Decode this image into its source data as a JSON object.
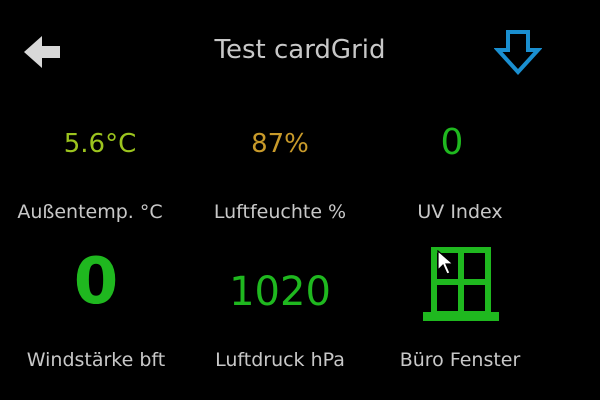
{
  "header": {
    "title": "Test cardGrid",
    "back_icon": "arrow-left-icon",
    "down_icon": "arrow-down-icon"
  },
  "colors": {
    "temp": "#9cc41e",
    "humidity": "#c89a2a",
    "green": "#1fb81f",
    "down_arrow": "#1a8fd0",
    "back_arrow": "#d8d8d8",
    "label": "#c8c8c8"
  },
  "cards": [
    {
      "value": "5.6°C",
      "label": "Außentemp. °C"
    },
    {
      "value": "87%",
      "label": "Luftfeuchte %"
    },
    {
      "value": "0",
      "label": "UV Index"
    },
    {
      "value": "0",
      "label": "Windstärke bft"
    },
    {
      "value": "1020",
      "label": "Luftdruck hPa"
    },
    {
      "value_icon": "window-icon",
      "label": "Büro Fenster"
    }
  ]
}
